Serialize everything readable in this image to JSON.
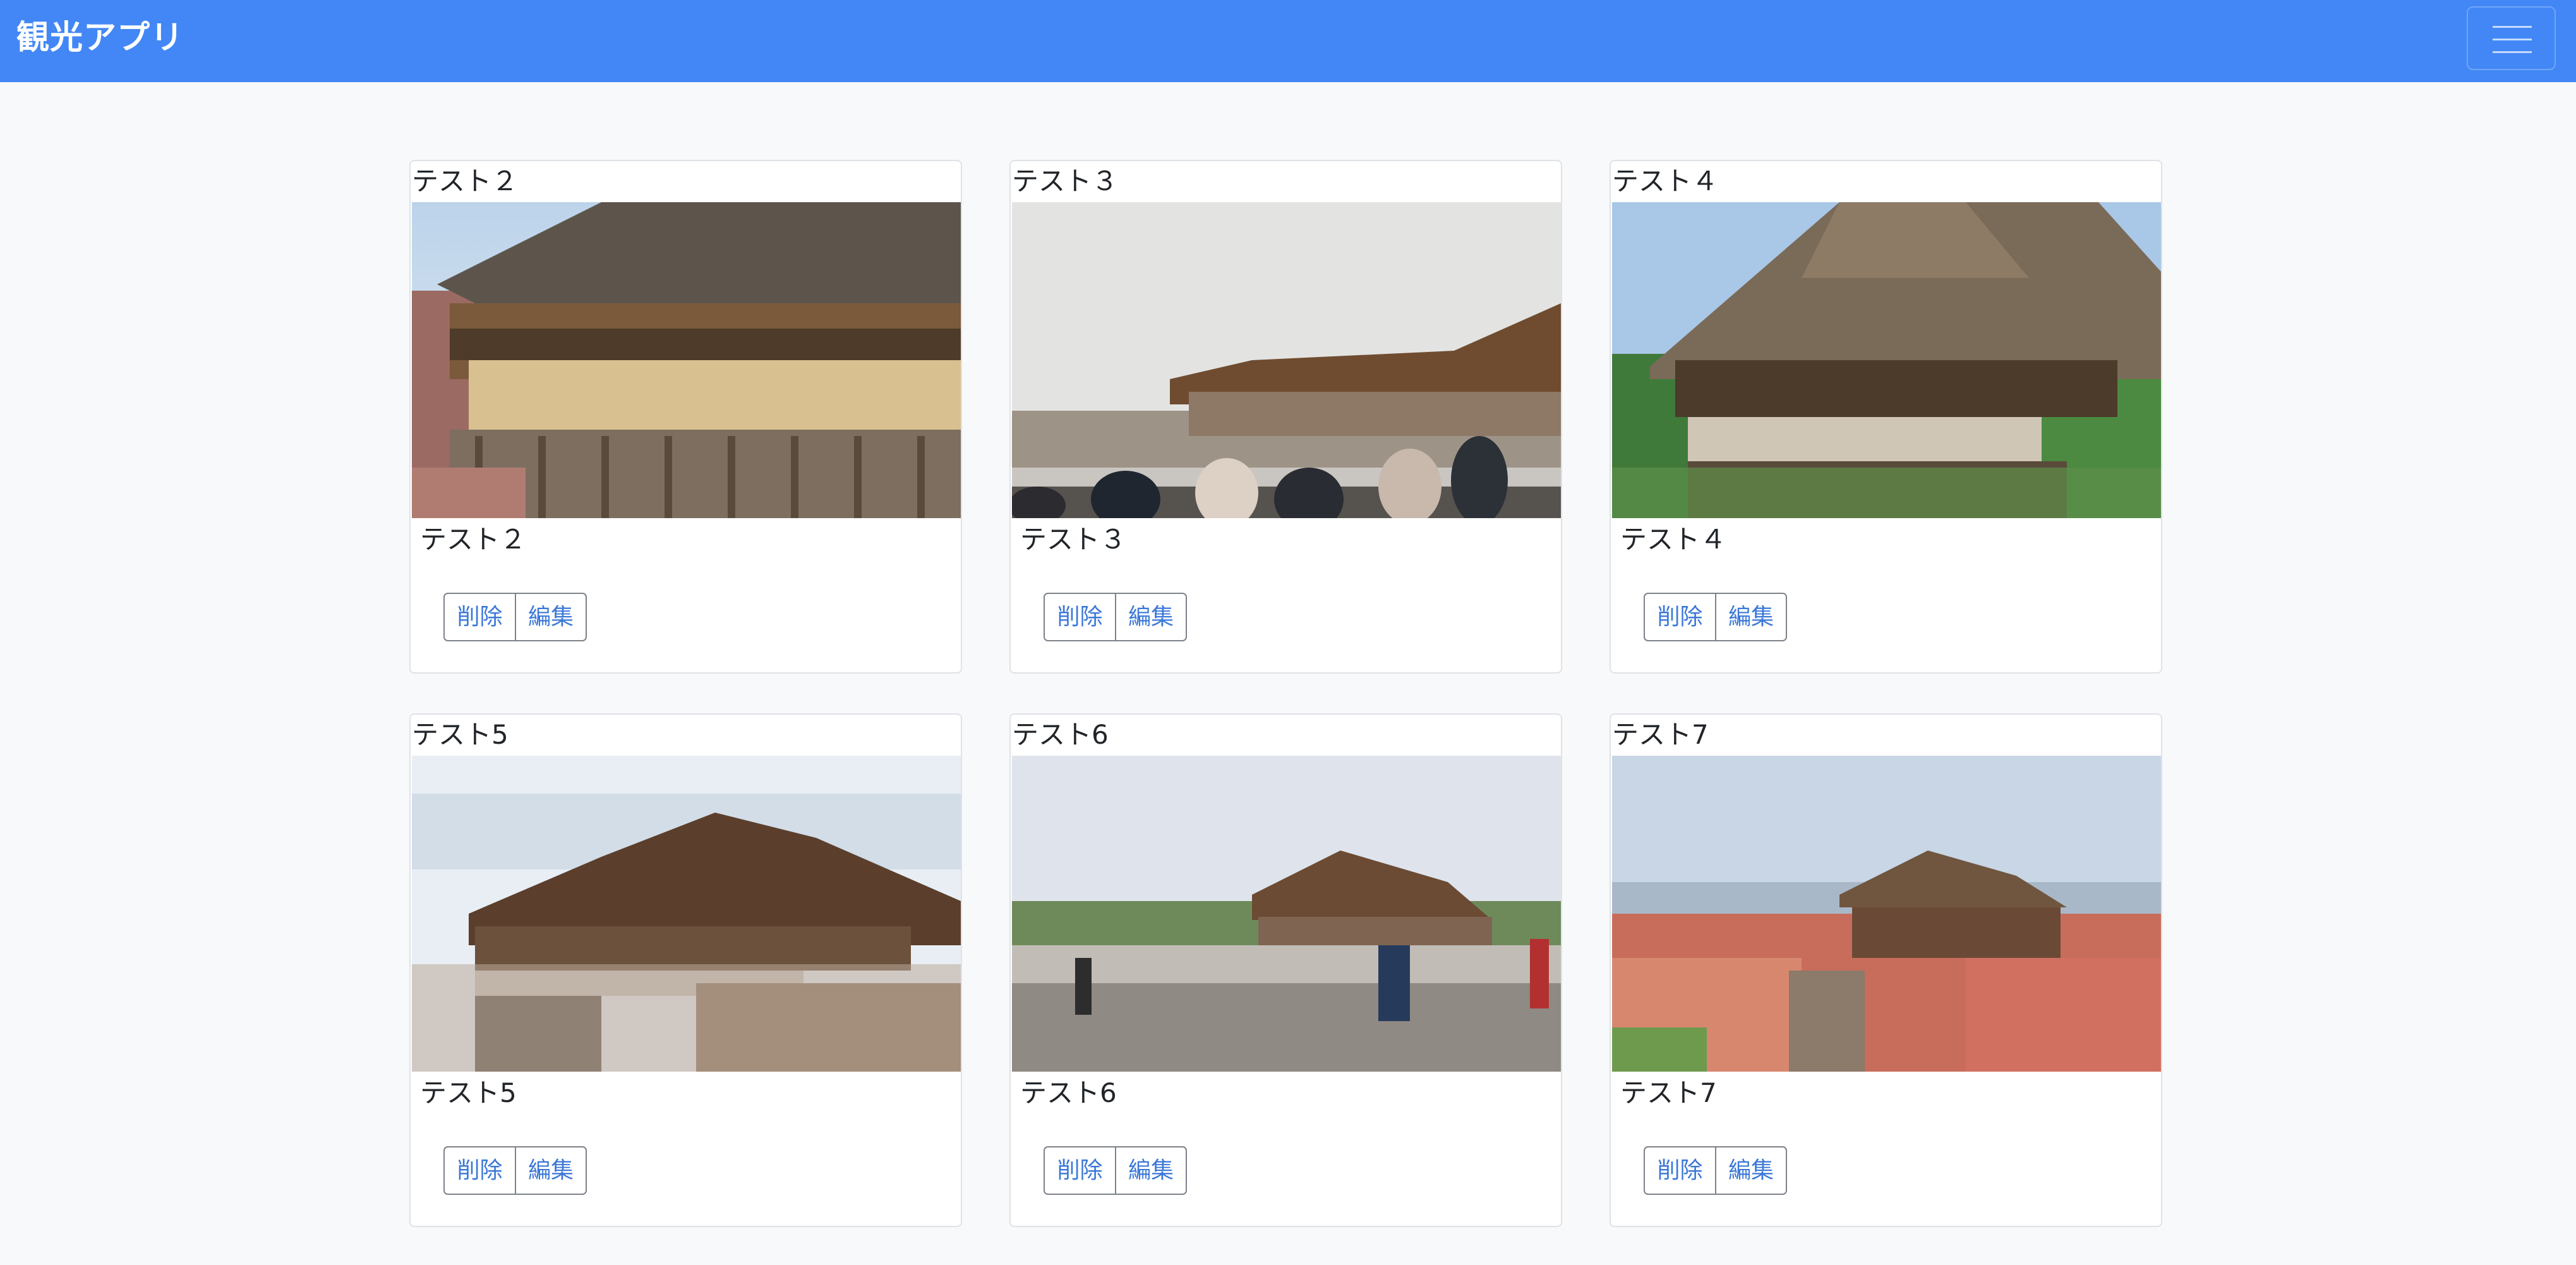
{
  "app": {
    "title": "観光アプリ"
  },
  "cards": [
    {
      "header": "テスト２",
      "title": "テスト２",
      "delete_label": "削除",
      "edit_label": "編集"
    },
    {
      "header": "テスト３",
      "title": "テスト３",
      "delete_label": "削除",
      "edit_label": "編集"
    },
    {
      "header": "テスト４",
      "title": "テスト４",
      "delete_label": "削除",
      "edit_label": "編集"
    },
    {
      "header": "テスト5",
      "title": "テスト5",
      "delete_label": "削除",
      "edit_label": "編集"
    },
    {
      "header": "テスト6",
      "title": "テスト6",
      "delete_label": "削除",
      "edit_label": "編集"
    },
    {
      "header": "テスト7",
      "title": "テスト7",
      "delete_label": "削除",
      "edit_label": "編集"
    }
  ],
  "icons": {
    "menu": "hamburger-menu-icon"
  },
  "colors": {
    "navbar": "#4287f5",
    "button_text": "#3b78d8",
    "page_background": "#f8f9fa"
  }
}
